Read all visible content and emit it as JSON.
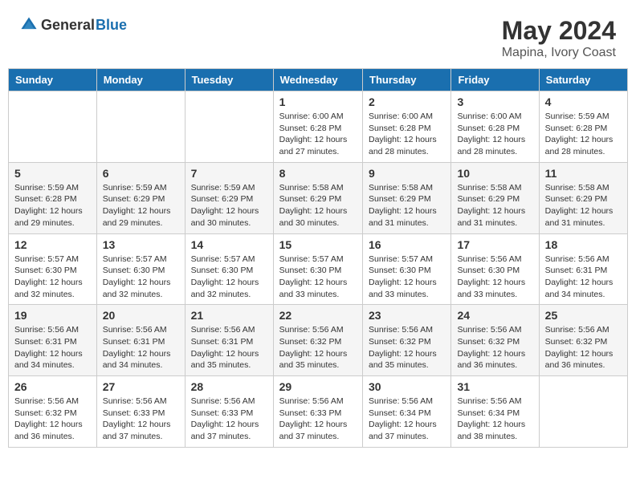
{
  "logo": {
    "text_general": "General",
    "text_blue": "Blue"
  },
  "title": {
    "month_year": "May 2024",
    "location": "Mapina, Ivory Coast"
  },
  "headers": [
    "Sunday",
    "Monday",
    "Tuesday",
    "Wednesday",
    "Thursday",
    "Friday",
    "Saturday"
  ],
  "weeks": [
    [
      {
        "day": "",
        "sunrise": "",
        "sunset": "",
        "daylight": ""
      },
      {
        "day": "",
        "sunrise": "",
        "sunset": "",
        "daylight": ""
      },
      {
        "day": "",
        "sunrise": "",
        "sunset": "",
        "daylight": ""
      },
      {
        "day": "1",
        "sunrise": "Sunrise: 6:00 AM",
        "sunset": "Sunset: 6:28 PM",
        "daylight": "Daylight: 12 hours and 27 minutes."
      },
      {
        "day": "2",
        "sunrise": "Sunrise: 6:00 AM",
        "sunset": "Sunset: 6:28 PM",
        "daylight": "Daylight: 12 hours and 28 minutes."
      },
      {
        "day": "3",
        "sunrise": "Sunrise: 6:00 AM",
        "sunset": "Sunset: 6:28 PM",
        "daylight": "Daylight: 12 hours and 28 minutes."
      },
      {
        "day": "4",
        "sunrise": "Sunrise: 5:59 AM",
        "sunset": "Sunset: 6:28 PM",
        "daylight": "Daylight: 12 hours and 28 minutes."
      }
    ],
    [
      {
        "day": "5",
        "sunrise": "Sunrise: 5:59 AM",
        "sunset": "Sunset: 6:28 PM",
        "daylight": "Daylight: 12 hours and 29 minutes."
      },
      {
        "day": "6",
        "sunrise": "Sunrise: 5:59 AM",
        "sunset": "Sunset: 6:29 PM",
        "daylight": "Daylight: 12 hours and 29 minutes."
      },
      {
        "day": "7",
        "sunrise": "Sunrise: 5:59 AM",
        "sunset": "Sunset: 6:29 PM",
        "daylight": "Daylight: 12 hours and 30 minutes."
      },
      {
        "day": "8",
        "sunrise": "Sunrise: 5:58 AM",
        "sunset": "Sunset: 6:29 PM",
        "daylight": "Daylight: 12 hours and 30 minutes."
      },
      {
        "day": "9",
        "sunrise": "Sunrise: 5:58 AM",
        "sunset": "Sunset: 6:29 PM",
        "daylight": "Daylight: 12 hours and 31 minutes."
      },
      {
        "day": "10",
        "sunrise": "Sunrise: 5:58 AM",
        "sunset": "Sunset: 6:29 PM",
        "daylight": "Daylight: 12 hours and 31 minutes."
      },
      {
        "day": "11",
        "sunrise": "Sunrise: 5:58 AM",
        "sunset": "Sunset: 6:29 PM",
        "daylight": "Daylight: 12 hours and 31 minutes."
      }
    ],
    [
      {
        "day": "12",
        "sunrise": "Sunrise: 5:57 AM",
        "sunset": "Sunset: 6:30 PM",
        "daylight": "Daylight: 12 hours and 32 minutes."
      },
      {
        "day": "13",
        "sunrise": "Sunrise: 5:57 AM",
        "sunset": "Sunset: 6:30 PM",
        "daylight": "Daylight: 12 hours and 32 minutes."
      },
      {
        "day": "14",
        "sunrise": "Sunrise: 5:57 AM",
        "sunset": "Sunset: 6:30 PM",
        "daylight": "Daylight: 12 hours and 32 minutes."
      },
      {
        "day": "15",
        "sunrise": "Sunrise: 5:57 AM",
        "sunset": "Sunset: 6:30 PM",
        "daylight": "Daylight: 12 hours and 33 minutes."
      },
      {
        "day": "16",
        "sunrise": "Sunrise: 5:57 AM",
        "sunset": "Sunset: 6:30 PM",
        "daylight": "Daylight: 12 hours and 33 minutes."
      },
      {
        "day": "17",
        "sunrise": "Sunrise: 5:56 AM",
        "sunset": "Sunset: 6:30 PM",
        "daylight": "Daylight: 12 hours and 33 minutes."
      },
      {
        "day": "18",
        "sunrise": "Sunrise: 5:56 AM",
        "sunset": "Sunset: 6:31 PM",
        "daylight": "Daylight: 12 hours and 34 minutes."
      }
    ],
    [
      {
        "day": "19",
        "sunrise": "Sunrise: 5:56 AM",
        "sunset": "Sunset: 6:31 PM",
        "daylight": "Daylight: 12 hours and 34 minutes."
      },
      {
        "day": "20",
        "sunrise": "Sunrise: 5:56 AM",
        "sunset": "Sunset: 6:31 PM",
        "daylight": "Daylight: 12 hours and 34 minutes."
      },
      {
        "day": "21",
        "sunrise": "Sunrise: 5:56 AM",
        "sunset": "Sunset: 6:31 PM",
        "daylight": "Daylight: 12 hours and 35 minutes."
      },
      {
        "day": "22",
        "sunrise": "Sunrise: 5:56 AM",
        "sunset": "Sunset: 6:32 PM",
        "daylight": "Daylight: 12 hours and 35 minutes."
      },
      {
        "day": "23",
        "sunrise": "Sunrise: 5:56 AM",
        "sunset": "Sunset: 6:32 PM",
        "daylight": "Daylight: 12 hours and 35 minutes."
      },
      {
        "day": "24",
        "sunrise": "Sunrise: 5:56 AM",
        "sunset": "Sunset: 6:32 PM",
        "daylight": "Daylight: 12 hours and 36 minutes."
      },
      {
        "day": "25",
        "sunrise": "Sunrise: 5:56 AM",
        "sunset": "Sunset: 6:32 PM",
        "daylight": "Daylight: 12 hours and 36 minutes."
      }
    ],
    [
      {
        "day": "26",
        "sunrise": "Sunrise: 5:56 AM",
        "sunset": "Sunset: 6:32 PM",
        "daylight": "Daylight: 12 hours and 36 minutes."
      },
      {
        "day": "27",
        "sunrise": "Sunrise: 5:56 AM",
        "sunset": "Sunset: 6:33 PM",
        "daylight": "Daylight: 12 hours and 37 minutes."
      },
      {
        "day": "28",
        "sunrise": "Sunrise: 5:56 AM",
        "sunset": "Sunset: 6:33 PM",
        "daylight": "Daylight: 12 hours and 37 minutes."
      },
      {
        "day": "29",
        "sunrise": "Sunrise: 5:56 AM",
        "sunset": "Sunset: 6:33 PM",
        "daylight": "Daylight: 12 hours and 37 minutes."
      },
      {
        "day": "30",
        "sunrise": "Sunrise: 5:56 AM",
        "sunset": "Sunset: 6:34 PM",
        "daylight": "Daylight: 12 hours and 37 minutes."
      },
      {
        "day": "31",
        "sunrise": "Sunrise: 5:56 AM",
        "sunset": "Sunset: 6:34 PM",
        "daylight": "Daylight: 12 hours and 38 minutes."
      },
      {
        "day": "",
        "sunrise": "",
        "sunset": "",
        "daylight": ""
      }
    ]
  ]
}
